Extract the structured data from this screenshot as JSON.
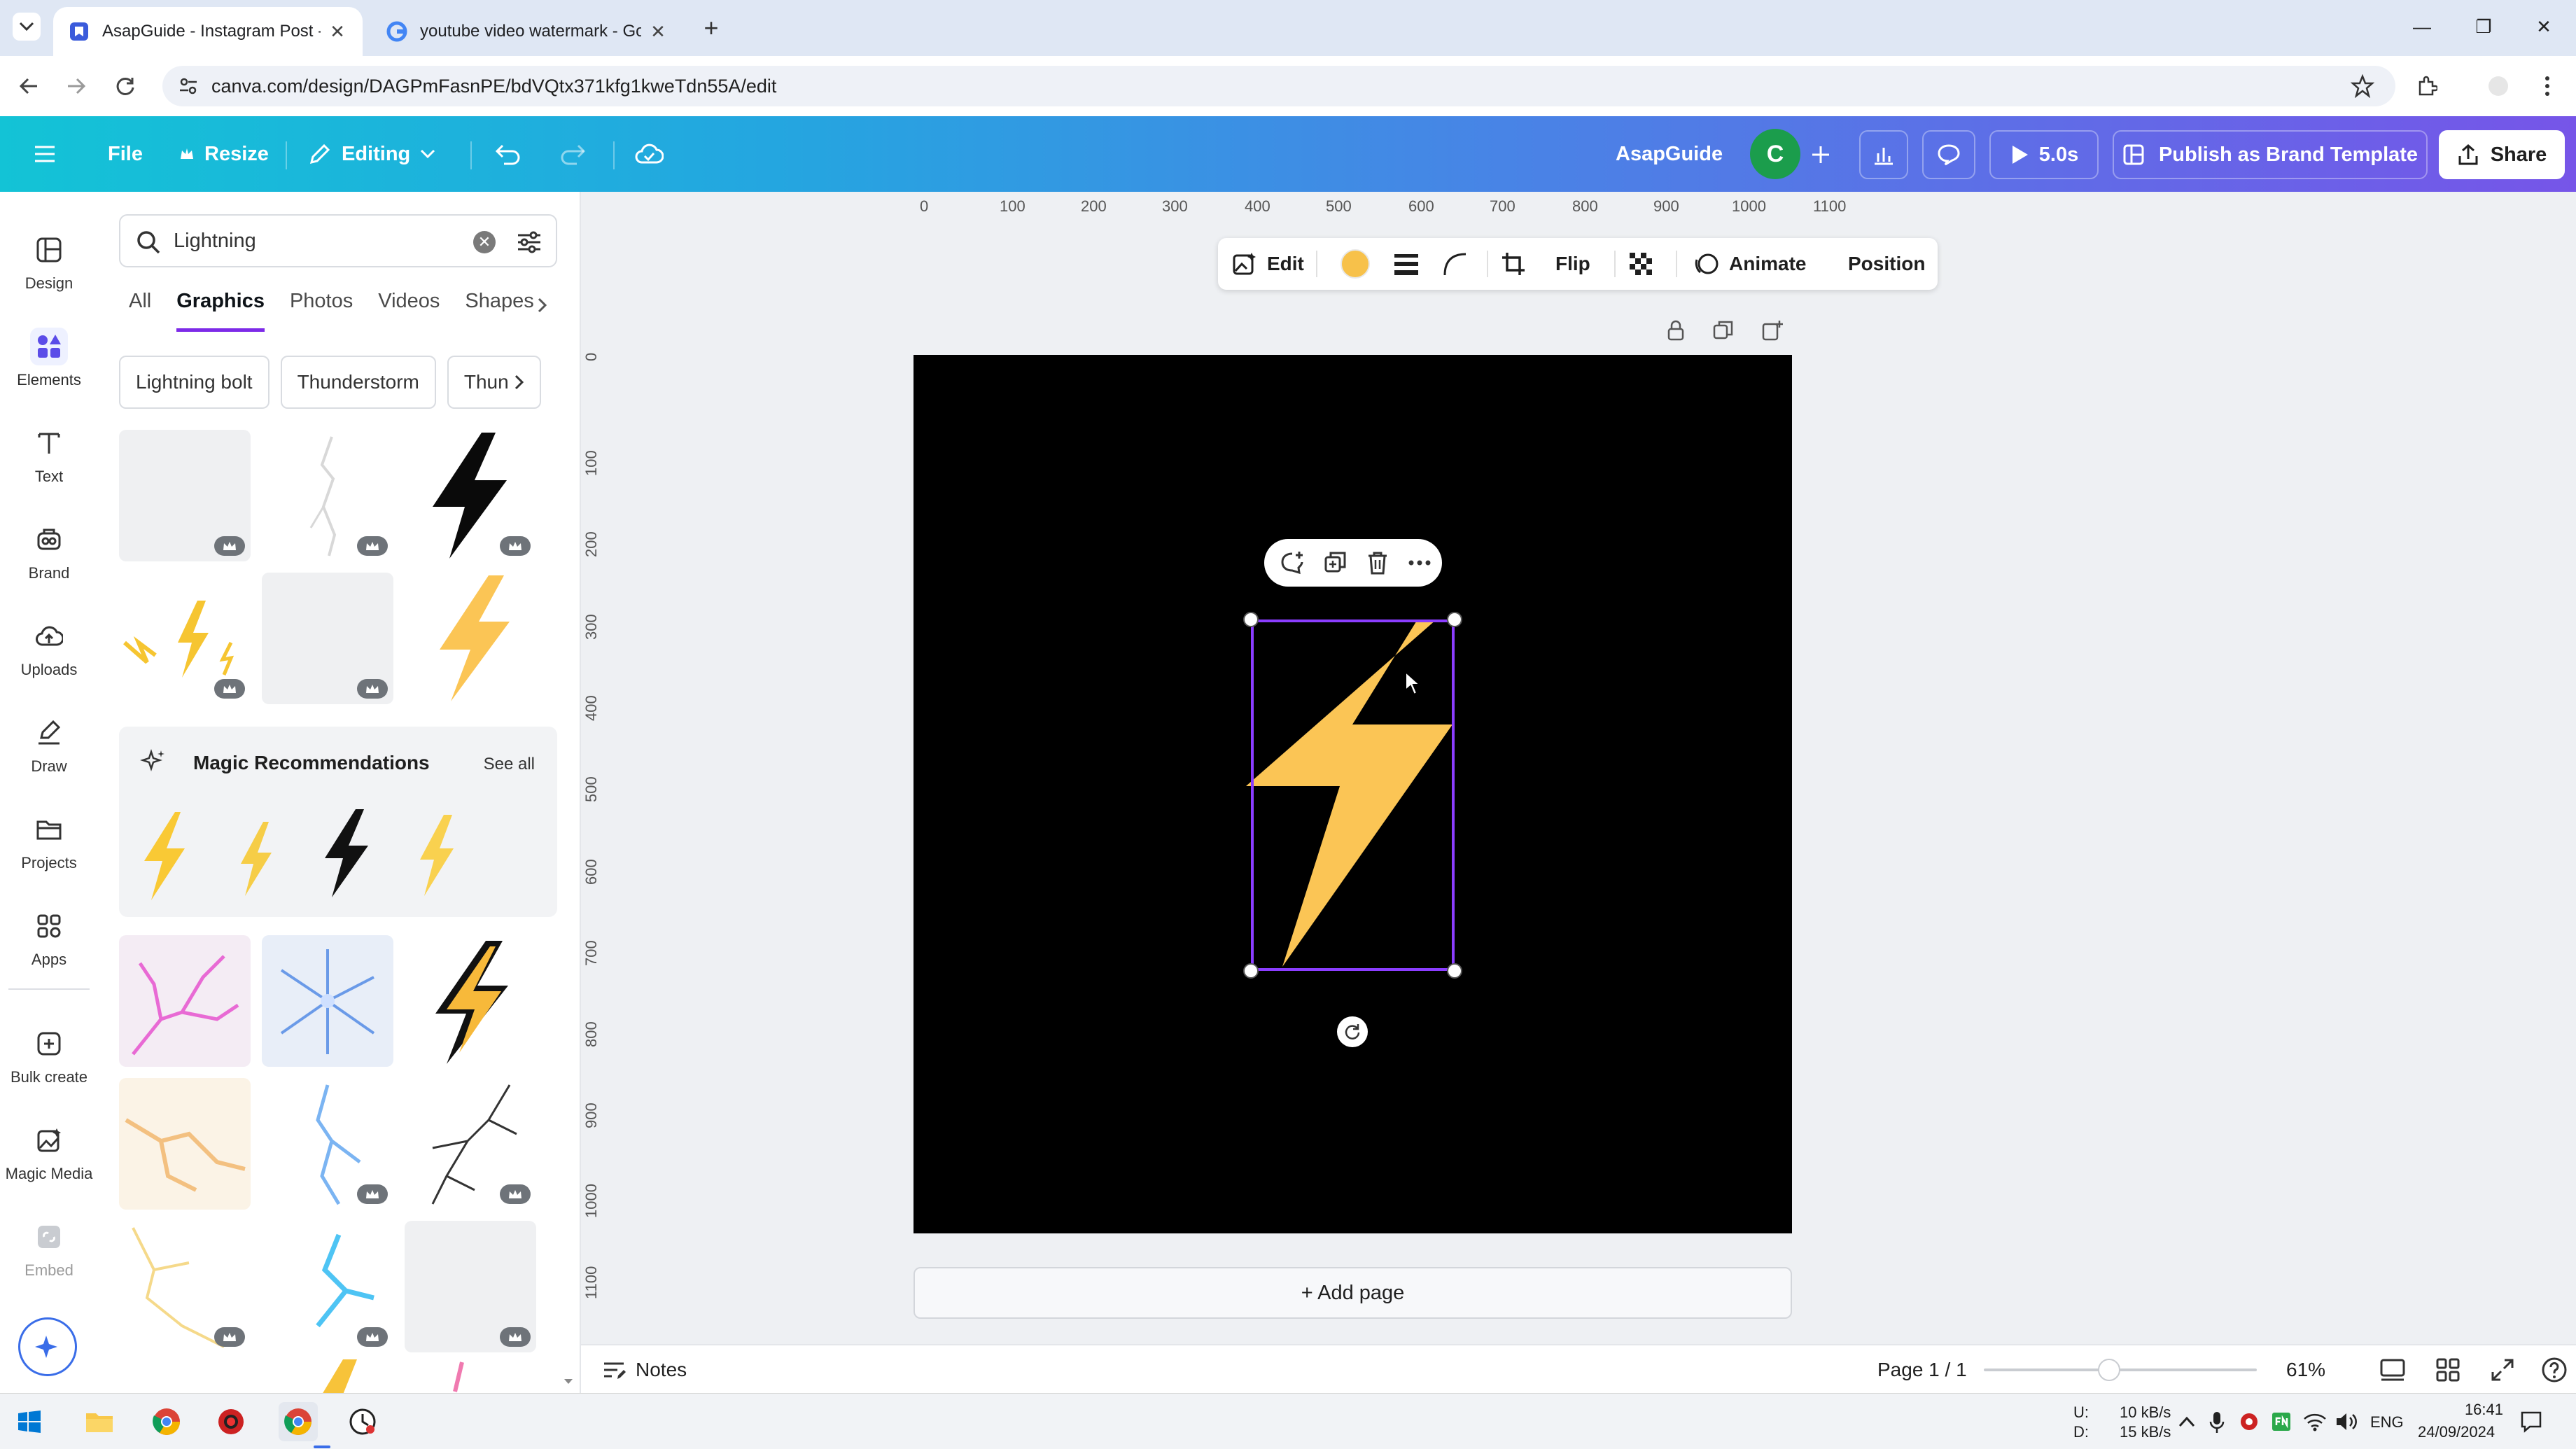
{
  "browser": {
    "tabs": [
      {
        "title": "AsapGuide - Instagram Post - C"
      },
      {
        "title": "youtube video watermark - Go"
      }
    ],
    "url": "canva.com/design/DAGPmFasnPE/bdVQtx371kfg1kweTdn55A/edit"
  },
  "header": {
    "file": "File",
    "resize": "Resize",
    "editing": "Editing",
    "team_name": "AsapGuide",
    "avatar_letter": "C",
    "play_duration": "5.0s",
    "publish": "Publish as Brand Template",
    "share": "Share",
    "gradient_start": "#13c3d6",
    "gradient_end": "#7655e8"
  },
  "rail": [
    {
      "label": "Design",
      "icon": "layout-icon"
    },
    {
      "label": "Elements",
      "icon": "elements-icon"
    },
    {
      "label": "Text",
      "icon": "text-icon"
    },
    {
      "label": "Brand",
      "icon": "brand-icon"
    },
    {
      "label": "Uploads",
      "icon": "cloud-upload-icon"
    },
    {
      "label": "Draw",
      "icon": "pen-icon"
    },
    {
      "label": "Projects",
      "icon": "folder-icon"
    },
    {
      "label": "Apps",
      "icon": "apps-icon"
    },
    {
      "label": "Bulk create",
      "icon": "bulk-create-icon"
    },
    {
      "label": "Magic Media",
      "icon": "magic-media-icon"
    },
    {
      "label": "Embed",
      "icon": "embed-icon"
    }
  ],
  "panel": {
    "search_value": "Lightning",
    "categories": [
      "All",
      "Graphics",
      "Photos",
      "Videos",
      "Shapes"
    ],
    "active_category": "Graphics",
    "chips": [
      "Lightning bolt",
      "Thunderstorm",
      "Thun"
    ],
    "magic_title": "Magic Recommendations",
    "see_all": "See all"
  },
  "ruler": {
    "top": [
      "0",
      "100",
      "200",
      "300",
      "400",
      "500",
      "600",
      "700",
      "800",
      "900",
      "1000",
      "1100"
    ],
    "left": [
      "0",
      "100",
      "200",
      "300",
      "400",
      "500",
      "600",
      "700",
      "800",
      "900",
      "1000",
      "1100"
    ]
  },
  "toolbar": {
    "edit": "Edit",
    "flip": "Flip",
    "animate": "Animate",
    "position": "Position",
    "fill_color": "#f7c14a"
  },
  "canvas": {
    "background": "#000000",
    "element_color": "#fbc555",
    "add_page": "+ Add page"
  },
  "footer": {
    "notes": "Notes",
    "page": "Page 1 / 1",
    "zoom": "61%",
    "zoom_level": 0.46
  },
  "taskbar": {
    "net_up_label": "U:",
    "net_down_label": "D:",
    "net_up": "10 kB/s",
    "net_down": "15 kB/s",
    "lang": "ENG",
    "time": "16:41",
    "date": "24/09/2024"
  }
}
